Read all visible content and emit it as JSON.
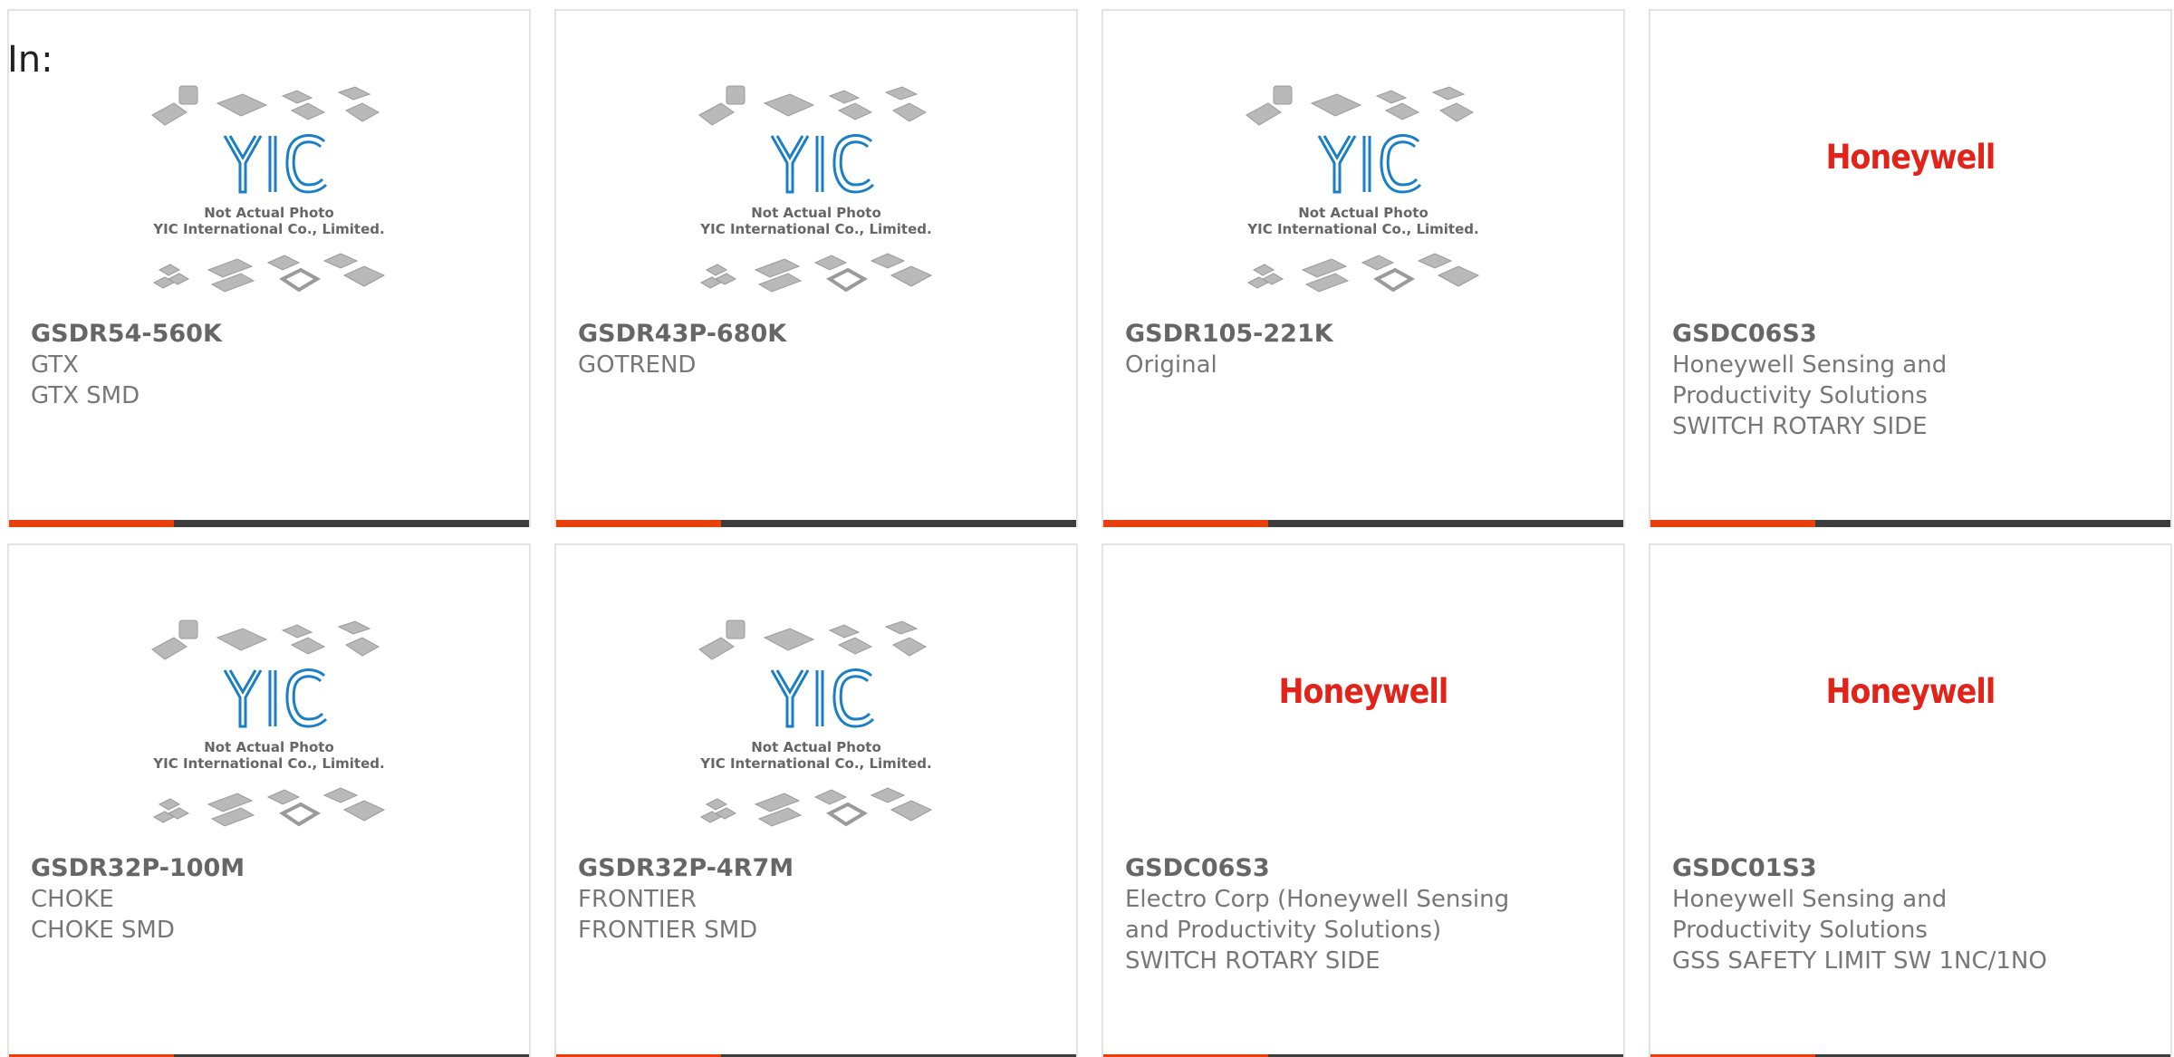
{
  "header": {
    "label": "In:"
  },
  "colors": {
    "accent": "#e8400c",
    "bar": "#3d3d3d",
    "honeywell_red": "#e2231a",
    "yic_blue": "#1a7fc4"
  },
  "placeholder_image": {
    "logo_text": "YIC",
    "line1": "Not Actual Photo",
    "line2": "YIC International Co., Limited."
  },
  "cards": [
    {
      "part": "GSDR54-560K",
      "image": "yic-placeholder",
      "lines": [
        "GTX",
        "GTX SMD"
      ]
    },
    {
      "part": "GSDR43P-680K",
      "image": "yic-placeholder",
      "lines": [
        "GOTREND"
      ]
    },
    {
      "part": "GSDR105-221K",
      "image": "yic-placeholder",
      "lines": [
        "Original"
      ]
    },
    {
      "part": "GSDC06S3",
      "image": "honeywell-logo",
      "logo_text": "Honeywell",
      "lines": [
        "Honeywell Sensing and",
        "Productivity Solutions",
        "SWITCH ROTARY SIDE"
      ]
    },
    {
      "part": "GSDR32P-100M",
      "image": "yic-placeholder",
      "lines": [
        "CHOKE",
        "CHOKE SMD"
      ]
    },
    {
      "part": "GSDR32P-4R7M",
      "image": "yic-placeholder",
      "lines": [
        "FRONTIER",
        "FRONTIER SMD"
      ]
    },
    {
      "part": "GSDC06S3",
      "image": "honeywell-logo",
      "logo_text": "Honeywell",
      "lines": [
        "Electro Corp (Honeywell Sensing",
        "and Productivity Solutions)",
        "SWITCH ROTARY SIDE"
      ]
    },
    {
      "part": "GSDC01S3",
      "image": "honeywell-logo",
      "logo_text": "Honeywell",
      "lines": [
        "Honeywell Sensing and",
        "Productivity Solutions",
        "GSS SAFETY LIMIT SW 1NC/1NO"
      ]
    }
  ]
}
